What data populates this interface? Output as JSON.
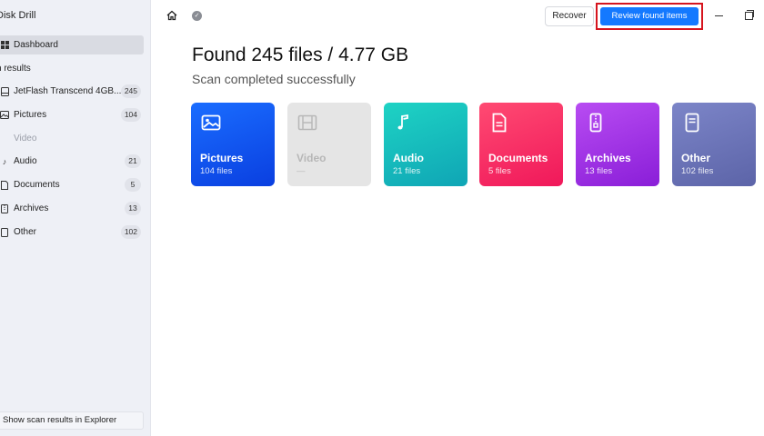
{
  "app": {
    "title": "Disk Drill"
  },
  "sidebar": {
    "dashboard_label": "Dashboard",
    "section_title": "n results",
    "items": [
      {
        "label": "JetFlash Transcend 4GB...",
        "count": "245",
        "icon": "drive-icon"
      },
      {
        "label": "Pictures",
        "count": "104",
        "icon": "image-icon"
      },
      {
        "label": "Video",
        "count": "",
        "icon": "video-icon",
        "disabled": true
      },
      {
        "label": "Audio",
        "count": "21",
        "icon": "music-icon"
      },
      {
        "label": "Documents",
        "count": "5",
        "icon": "document-icon"
      },
      {
        "label": "Archives",
        "count": "13",
        "icon": "archive-icon"
      },
      {
        "label": "Other",
        "count": "102",
        "icon": "file-icon"
      }
    ],
    "show_explorer_label": "Show scan results in Explorer"
  },
  "toolbar": {
    "recover_label": "Recover",
    "review_label": "Review found items"
  },
  "main": {
    "headline": "Found 245 files / 4.77 GB",
    "subline": "Scan completed successfully",
    "tiles": [
      {
        "name": "Pictures",
        "sub": "104 files",
        "color_from": "#1a6dff",
        "color_to": "#0a3fe0",
        "icon": "image-icon"
      },
      {
        "name": "Video",
        "sub": "—",
        "color_from": "#e5e5e5",
        "color_to": "#e5e5e5",
        "icon": "film-icon",
        "disabled": true
      },
      {
        "name": "Audio",
        "sub": "21 files",
        "color_from": "#1ed3c4",
        "color_to": "#0fa5b5",
        "icon": "music-icon"
      },
      {
        "name": "Documents",
        "sub": "5 files",
        "color_from": "#ff4a72",
        "color_to": "#f0185a",
        "icon": "document-icon"
      },
      {
        "name": "Archives",
        "sub": "13 files",
        "color_from": "#b84cf2",
        "color_to": "#8a1ed8",
        "icon": "archive-icon"
      },
      {
        "name": "Other",
        "sub": "102 files",
        "color_from": "#7c85c8",
        "color_to": "#5c64a8",
        "icon": "file-icon"
      }
    ]
  }
}
